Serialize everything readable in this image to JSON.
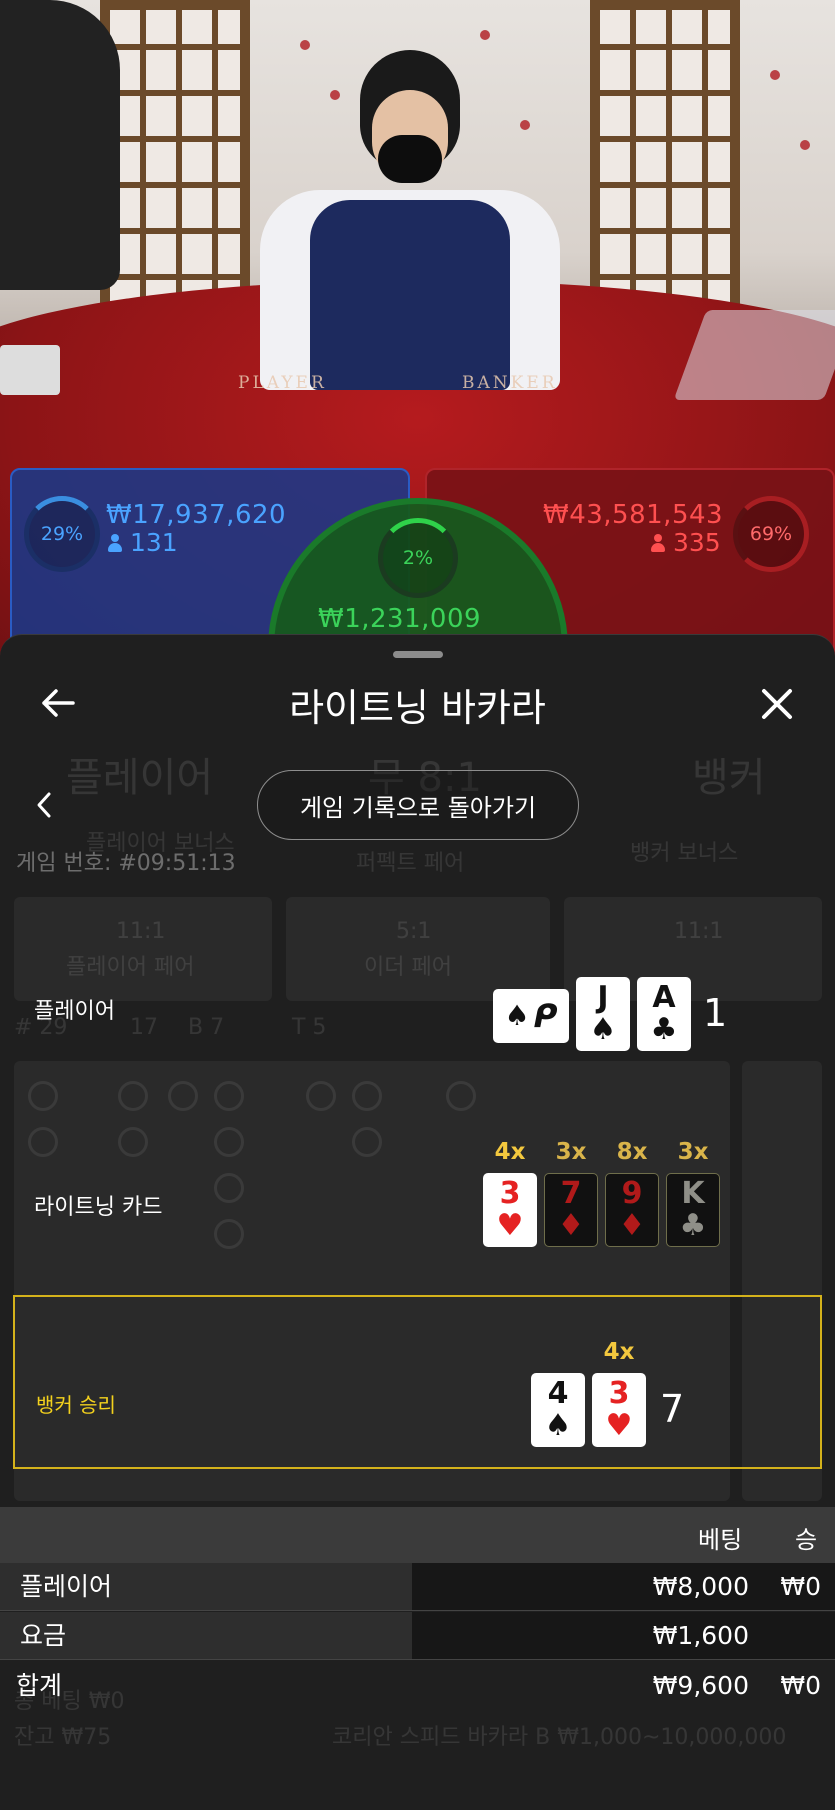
{
  "background": {
    "table_labels": [
      "PLAYER",
      "BANKER"
    ],
    "player_bets": {
      "percent": "29%",
      "amount": "₩17,937,620",
      "players": "131"
    },
    "tie_bets": {
      "percent": "2%",
      "amount": "₩1,231,009"
    },
    "banker_bets": {
      "percent": "69%",
      "amount": "₩43,581,543",
      "players": "335"
    },
    "ghost_text": {
      "player": "플레이어",
      "tie": "무 8:1",
      "banker": "뱅커",
      "game_number": "게임 번호: #09:51:13",
      "player_bonus": "플레이어 보너스",
      "perfect_pair": "퍼펙트 페어",
      "banker_bonus": "뱅커 보너스",
      "p_pair_odds": "11:1",
      "p_pair": "플레이어 페어",
      "either_odds": "5:1",
      "either_pair": "이더 페어",
      "b_pair_odds": "11:1",
      "stats": [
        "# 29",
        "17",
        "B 7",
        "T 5"
      ],
      "balance_bet": "총 베팅 ₩0",
      "balance": "잔고 ₩75",
      "table_name": "코리안 스피드 바카라 B ₩1,000~10,000,000"
    }
  },
  "sheet": {
    "title": "라이트닝 바카라",
    "history_button": "게임 기록으로 돌아가기",
    "player_row": {
      "label": "플레이어",
      "hidden_card_glyph": "ᑭ",
      "cards": [
        {
          "rank": "J",
          "suit": "♠",
          "color": "black"
        },
        {
          "rank": "A",
          "suit": "♣",
          "color": "black"
        }
      ],
      "total": "1"
    },
    "lightning_row": {
      "label": "라이트닝 카드",
      "cards": [
        {
          "rank": "3",
          "suit": "♥",
          "color": "red",
          "mult": "4x",
          "active": true
        },
        {
          "rank": "7",
          "suit": "♦",
          "color": "red",
          "mult": "3x",
          "active": false
        },
        {
          "rank": "9",
          "suit": "♦",
          "color": "red",
          "mult": "8x",
          "active": false
        },
        {
          "rank": "K",
          "suit": "♣",
          "color": "black",
          "mult": "3x",
          "active": false
        }
      ]
    },
    "banker_row": {
      "label": "뱅커 승리",
      "cards": [
        {
          "rank": "4",
          "suit": "♠",
          "color": "black"
        },
        {
          "rank": "3",
          "suit": "♥",
          "color": "red",
          "mult": "4x"
        }
      ],
      "total": "7"
    },
    "table": {
      "col_bet": "베팅",
      "col_win": "승",
      "rows": [
        {
          "label": "플레이어",
          "bet": "₩8,000",
          "win": "₩0"
        },
        {
          "label": "요금",
          "bet": "₩1,600",
          "win": ""
        }
      ],
      "total": {
        "label": "합계",
        "bet": "₩9,600",
        "win": "₩0"
      }
    }
  },
  "colors": {
    "player_blue": "#4aa3ff",
    "banker_red": "#ff5050",
    "tie_green": "#3bd35a",
    "win_yellow": "#f3d11d",
    "multiplier_gold": "#d9b44a"
  }
}
